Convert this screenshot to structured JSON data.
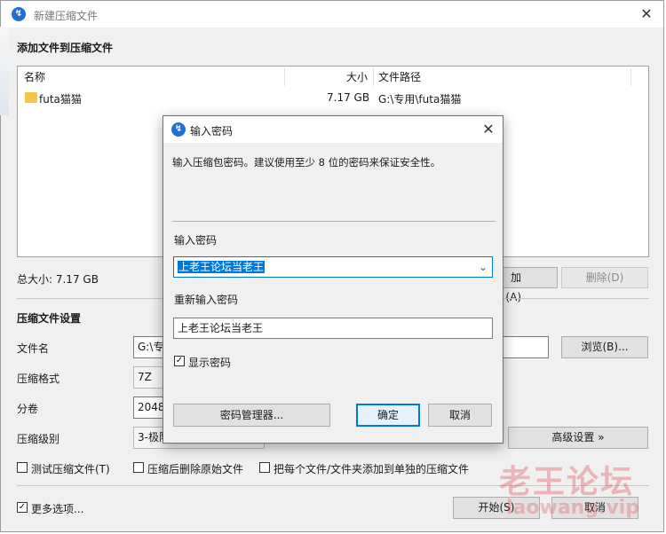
{
  "main_window": {
    "title": "新建压缩文件",
    "add_files_heading": "添加文件到压缩文件",
    "columns": {
      "name": "名称",
      "size": "大小",
      "path": "文件路径"
    },
    "rows": [
      {
        "name": "futa猫猫",
        "size": "7.17 GB",
        "path": "G:\\专用\\futa猫猫"
      }
    ],
    "total_size": "总大小: 7.17 GB",
    "add_button": "添加(A)",
    "add_button_visible": "加(A)",
    "delete_button": "删除(D)",
    "settings_heading": "压缩文件设置",
    "filename_label": "文件名",
    "filename_value": "G:\\专",
    "browse_button": "浏览(B)...",
    "format_label": "压缩格式",
    "format_value": "7Z",
    "volume_label": "分卷",
    "volume_value": "2048",
    "level_label": "压缩级别",
    "level_value": "3-极限压缩",
    "advanced_button": "高级设置 »",
    "test_archive": "测试压缩文件(T)",
    "delete_after": "压缩后删除原始文件",
    "each_separately": "把每个文件/文件夹添加到单独的压缩文件",
    "more_options": "更多选项...",
    "start_button": "开始(S)",
    "cancel_button": "取消"
  },
  "password_dialog": {
    "title": "输入密码",
    "description": "输入压缩包密码。建议使用至少 8 位的密码来保证安全性。",
    "password_label": "输入密码",
    "password_value": "上老王论坛当老王",
    "reenter_label": "重新输入密码",
    "reenter_value": "上老王论坛当老王",
    "show_password": "显示密码",
    "manager_button": "密码管理器...",
    "ok_button": "确定",
    "cancel_button": "取消"
  },
  "watermark": {
    "cn": "老王论坛",
    "en": "laowang.vip"
  },
  "icons": [
    "app-icon",
    "close-icon",
    "folder-icon",
    "chevron-down-icon",
    "checkbox-check-icon"
  ],
  "colors": {
    "accent": "#0078d7",
    "folder": "#f5c64b",
    "watermark": "#e64650"
  }
}
